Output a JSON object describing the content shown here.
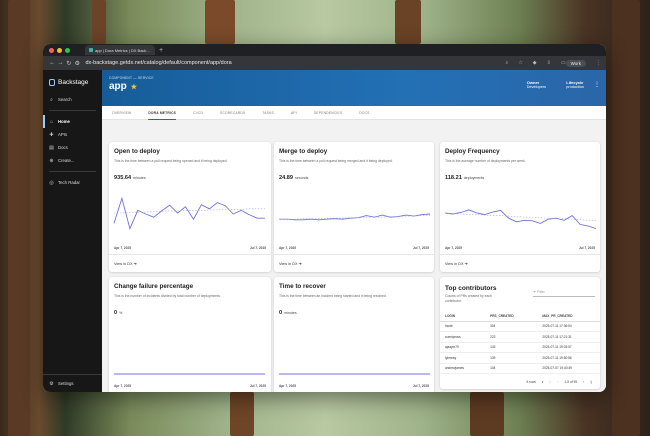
{
  "browser": {
    "tab_title": "app | Dora Metrics | DX Back…",
    "url": "dx-backstage.getdx.net/catalog/default/component/app/dora",
    "profile": "Work"
  },
  "sidebar": {
    "brand": "Backstage",
    "search": "Search",
    "items": [
      {
        "label": "Home",
        "icon": "home-icon"
      },
      {
        "label": "APIs",
        "icon": "puzzle-icon"
      },
      {
        "label": "Docs",
        "icon": "docs-icon"
      },
      {
        "label": "Create...",
        "icon": "plus-circle-icon"
      }
    ],
    "tech_radar": "Tech Radar",
    "settings": "Settings"
  },
  "header": {
    "breadcrumb": "COMPONENT — SERVICE",
    "title": "app",
    "owner_label": "Owner",
    "owner_value": "Developers",
    "lifecycle_label": "Lifecycle",
    "lifecycle_value": "production"
  },
  "entity_tabs": [
    "OVERVIEW",
    "DORA METRICS",
    "CI/CD",
    "SCORECARDS",
    "TASKS",
    "API",
    "DEPENDENCIES",
    "DOCS"
  ],
  "cards": [
    {
      "title": "Open to deploy",
      "desc": "This is the time between a pull request being opened and it being deployed.",
      "value": "935.64",
      "unit": "minutes",
      "date_start": "Apr 7, 2025",
      "date_end": "Jul 7, 2025",
      "link": "View in DX ➔"
    },
    {
      "title": "Merge to deploy",
      "desc": "This is the time between a pull request being merged and it being deployed.",
      "value": "24.89",
      "unit": "seconds",
      "date_start": "Apr 7, 2025",
      "date_end": "Jul 7, 2025",
      "link": "View in DX ➔"
    },
    {
      "title": "Deploy Frequency",
      "desc": "This is the average number of deployments per week.",
      "value": "118.21",
      "unit": "deployments",
      "date_start": "Apr 7, 2025",
      "date_end": "Jul 7, 2025",
      "link": "View in DX ➔"
    },
    {
      "title": "Change failure percentage",
      "desc": "This is the number of incidents divided by total number of deployments.",
      "value": "0",
      "unit": "%",
      "date_start": "Apr 7, 2025",
      "date_end": "Jul 7, 2025",
      "link": "View in DX ➔"
    },
    {
      "title": "Time to recover",
      "desc": "This is the time between an incident being started and it being resolved.",
      "value": "0",
      "unit": "minutes",
      "date_start": "Apr 7, 2025",
      "date_end": "Jul 7, 2025",
      "link": "View in DX ➔"
    }
  ],
  "contributors": {
    "title": "Top contributors",
    "desc": "Counts of PRs created by each contributor.",
    "filter_placeholder": "Filter",
    "columns": [
      "LOGIN",
      "PRS_CREATED",
      "MAX_PR_CREATED"
    ],
    "rows": [
      [
        "lnode",
        "304",
        "2025-07-11 17:36:54"
      ],
      [
        "cuentpross",
        "223",
        "2025-07-11 17:21:31"
      ],
      [
        "ajaaym79",
        "143",
        "2025-07-11 19:03:57"
      ],
      [
        "fylereay",
        "139",
        "2025-07-11 19:50:56"
      ],
      [
        "andrewjames",
        "104",
        "2025-07-07 19:40:49"
      ]
    ],
    "rows_per_page": "5 rows",
    "page_info": "1-5 of 95"
  },
  "chart_data": [
    {
      "type": "line",
      "title": "Open to deploy",
      "series": [
        {
          "values": [
            30,
            78,
            20,
            55,
            48,
            42,
            54,
            65,
            50,
            62,
            38,
            66,
            58,
            70,
            64,
            48,
            55,
            47,
            40,
            40
          ]
        },
        {
          "values": [
            50,
            50,
            51,
            52,
            52,
            53,
            53,
            54,
            54,
            55,
            55,
            55,
            56,
            56,
            57,
            57,
            57,
            58,
            58,
            58
          ]
        }
      ],
      "ylim": [
        0,
        100
      ]
    },
    {
      "type": "line",
      "title": "Merge to deploy",
      "series": [
        {
          "values": [
            38,
            38,
            37,
            37,
            38,
            37,
            38,
            39,
            38,
            40,
            41,
            45,
            42,
            46,
            42,
            43,
            46,
            44,
            47,
            48
          ]
        },
        {
          "values": [
            38,
            38,
            38,
            39,
            39,
            39,
            40,
            40,
            40,
            41,
            41,
            42,
            42,
            42,
            43,
            43,
            44,
            44,
            45,
            45
          ]
        }
      ],
      "ylim": [
        0,
        100
      ]
    },
    {
      "type": "line",
      "title": "Deploy Frequency",
      "series": [
        {
          "values": [
            50,
            48,
            51,
            56,
            50,
            47,
            52,
            55,
            40,
            33,
            36,
            35,
            30,
            38,
            40,
            36,
            45,
            28,
            25,
            20
          ]
        },
        {
          "values": [
            50,
            49,
            48,
            47,
            47,
            46,
            45,
            45,
            44,
            43,
            42,
            42,
            41,
            40,
            39,
            39,
            38,
            37,
            36,
            35
          ]
        }
      ],
      "ylim": [
        0,
        100
      ]
    },
    {
      "type": "line",
      "title": "Change failure percentage",
      "series": [
        {
          "values": [
            0,
            0,
            0,
            0,
            0,
            0,
            0,
            0,
            0,
            0,
            0,
            0,
            0,
            0,
            0,
            0,
            0,
            0,
            0,
            0
          ]
        }
      ],
      "ylim": [
        0,
        100
      ]
    },
    {
      "type": "line",
      "title": "Time to recover",
      "series": [
        {
          "values": [
            0,
            0,
            0,
            0,
            0,
            0,
            0,
            0,
            0,
            0,
            0,
            0,
            0,
            0,
            0,
            0,
            0,
            0,
            0,
            0
          ]
        }
      ],
      "ylim": [
        0,
        100
      ]
    }
  ]
}
